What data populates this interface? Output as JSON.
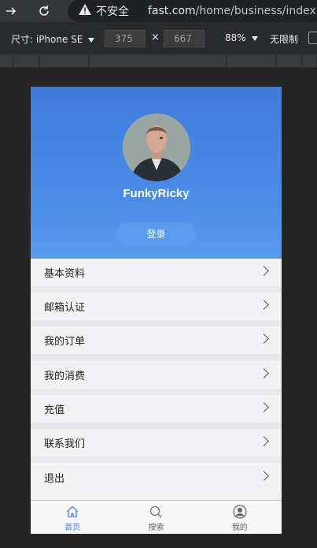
{
  "browser": {
    "insecure_label": "不安全",
    "url_host": "fast.com",
    "url_path": "/home/business/index.html"
  },
  "device_toolbar": {
    "device_label": "尺寸: iPhone SE",
    "width_value": "375",
    "times": "×",
    "height_value": "667",
    "zoom_label": "88%",
    "throttle_label": "无限制"
  },
  "profile": {
    "username": "FunkyRicky",
    "login_label": "登录"
  },
  "menu": {
    "items": [
      {
        "label": "基本资料"
      },
      {
        "label": "邮箱认证"
      },
      {
        "label": "我的订单"
      },
      {
        "label": "我的消费"
      },
      {
        "label": "充值"
      },
      {
        "label": "联系我们"
      },
      {
        "label": "退出"
      }
    ]
  },
  "tabbar": {
    "tabs": [
      {
        "label": "首页",
        "icon": "home-icon",
        "active": true
      },
      {
        "label": "搜索",
        "icon": "search-icon",
        "active": false
      },
      {
        "label": "我的",
        "icon": "user-icon",
        "active": false
      }
    ]
  },
  "colors": {
    "hero_top": "#3f7bdc",
    "hero_bottom": "#5a9bee",
    "active_tab": "#4a86e8"
  }
}
